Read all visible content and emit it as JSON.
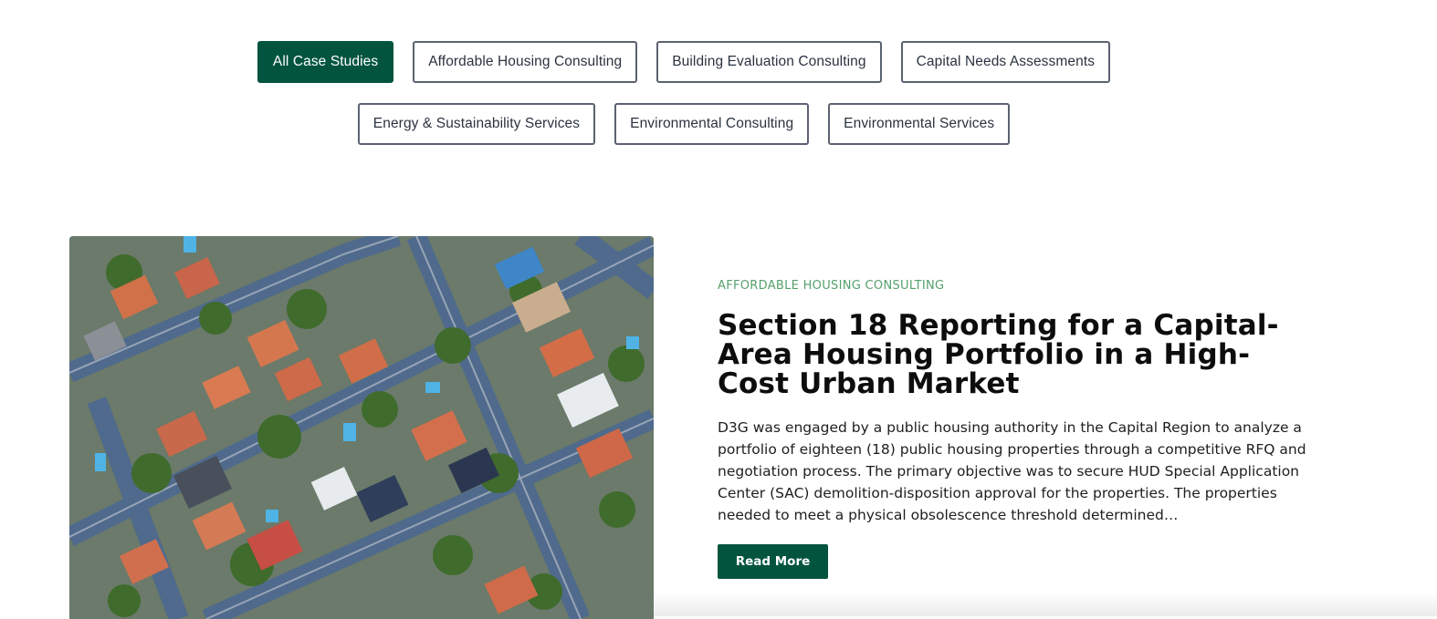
{
  "filters": {
    "row1": [
      "All Case Studies",
      "Affordable Housing Consulting",
      "Building Evaluation Consulting",
      "Capital Needs Assessments"
    ],
    "row2": [
      "Energy & Sustainability Services",
      "Environmental Consulting",
      "Environmental Services"
    ],
    "active": "All Case Studies"
  },
  "case_study": {
    "category": "AFFORDABLE HOUSING CONSULTING",
    "title": "Section 18 Reporting for a Capital-Area Housing Portfolio in a High-Cost Urban Market",
    "excerpt": "D3G was engaged by a public housing authority in the Capital Region to analyze a portfolio of eighteen (18) public housing properties through a competitive RFQ and negotiation process. The primary objective was to secure HUD Special Application Center (SAC) demolition-disposition approval for the properties. The properties needed to meet a physical obsolescence threshold determined…",
    "read_more_label": "Read More"
  },
  "colors": {
    "accent": "#03543f",
    "category": "#55a06c"
  }
}
